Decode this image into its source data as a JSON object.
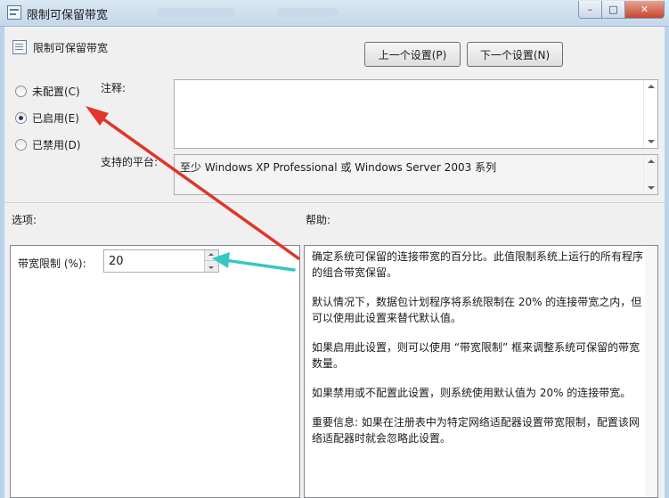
{
  "window": {
    "title": "限制可保留带宽",
    "buttons": {
      "minimize": "–",
      "maximize": "□",
      "close": "✕"
    }
  },
  "header": {
    "policy_name": "限制可保留带宽",
    "prev_button": "上一个设置(P)",
    "next_button": "下一个设置(N)"
  },
  "state": {
    "options": [
      {
        "label": "未配置(C)",
        "checked": false
      },
      {
        "label": "已启用(E)",
        "checked": true
      },
      {
        "label": "已禁用(D)",
        "checked": false
      }
    ]
  },
  "comment": {
    "label": "注释:",
    "value": ""
  },
  "platform": {
    "label": "支持的平台:",
    "value": "至少 Windows XP Professional 或 Windows Server 2003 系列"
  },
  "options_section": {
    "label": "选项:",
    "bandwidth_label": "带宽限制 (%):",
    "bandwidth_value": "20"
  },
  "help_section": {
    "label": "帮助:",
    "paragraphs": [
      "确定系统可保留的连接带宽的百分比。此值限制系统上运行的所有程序的组合带宽保留。",
      "默认情况下，数据包计划程序将系统限制在 20% 的连接带宽之内，但可以使用此设置来替代默认值。",
      "如果启用此设置，则可以使用 “带宽限制” 框来调整系统可保留的带宽数量。",
      "如果禁用或不配置此设置，则系统使用默认值为 20% 的连接带宽。",
      "重要信息: 如果在注册表中为特定网络适配器设置带宽限制，配置该网络适配器时就会忽略此设置。"
    ]
  },
  "colors": {
    "annotation_red": "#e2342a",
    "annotation_cyan": "#36c7c2"
  }
}
